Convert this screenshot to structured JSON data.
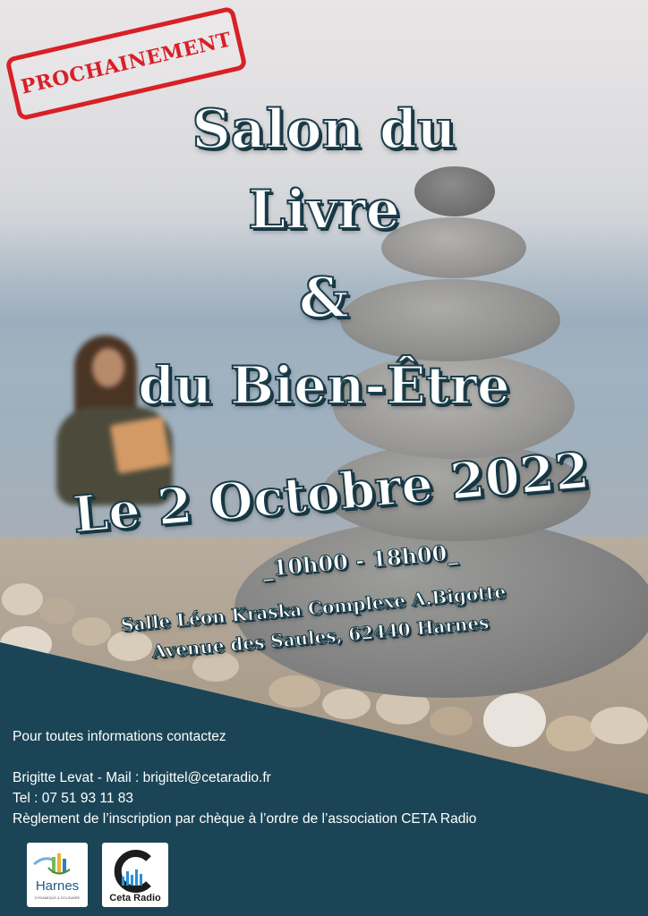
{
  "stamp": {
    "text": "PROCHAINEMENT"
  },
  "title": {
    "line1": "Salon du",
    "line2": "Livre",
    "line3": "&",
    "line4": "du Bien-Être"
  },
  "event": {
    "date": "Le 2 Octobre 2022",
    "hours": "_10h00 - 18h00_",
    "venue": "Salle Léon Kraska Complexe A.Bigotte",
    "address": "Avenue des Saules, 62440 Harnes"
  },
  "contact": {
    "intro": "Pour toutes informations contactez",
    "name_mail": "Brigitte Levat - Mail : brigittel@cetaradio.fr",
    "tel": "Tel : 07 51 93 11 83",
    "payment": "Règlement de l’inscription par chèque à l’ordre de l’association  CETA Radio"
  },
  "logos": {
    "harnes": {
      "name": "Harnes",
      "tagline": "DYNAMIQUE & SOLIDAIRE",
      "icon": "harnes-logo-icon"
    },
    "ceta": {
      "name": "Ceta Radio",
      "icon": "ceta-radio-logo-icon"
    }
  },
  "colors": {
    "stamp_red": "#d82026",
    "band": "#1b4556",
    "title_outline": "#1c3f4c",
    "text": "#ffffff"
  }
}
